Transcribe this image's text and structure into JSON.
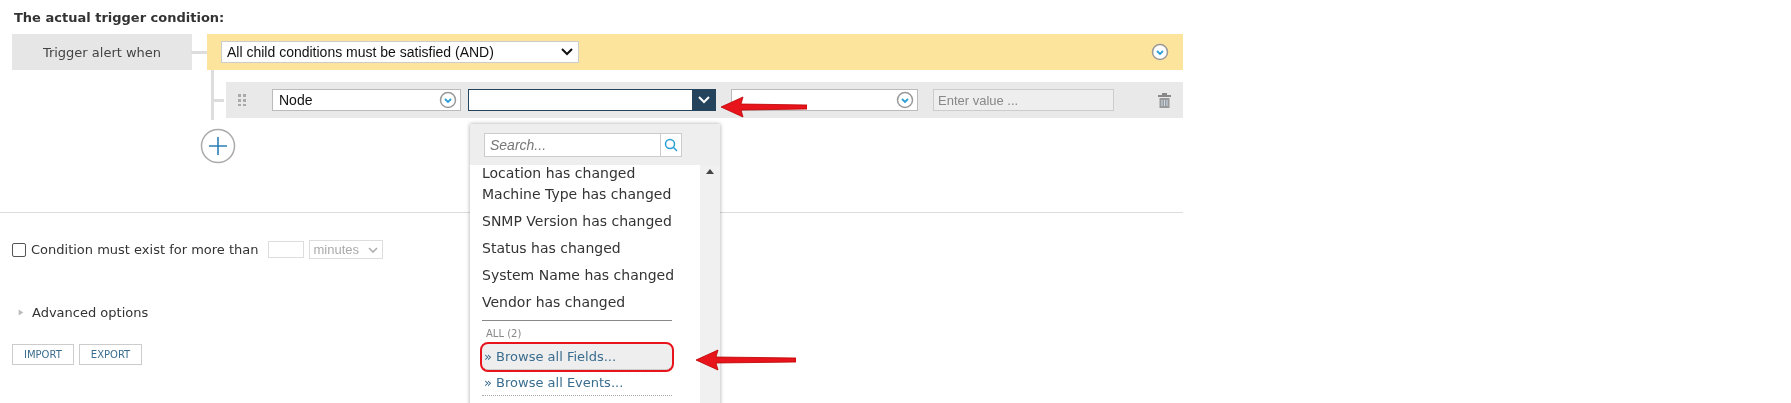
{
  "heading": "The actual trigger condition:",
  "trigger": {
    "label": "Trigger alert when",
    "mode": "All child conditions must be satisfied (AND)"
  },
  "condition": {
    "object": "Node",
    "value_placeholder": "Enter value ..."
  },
  "dropdown": {
    "search_placeholder": "Search...",
    "items": [
      "Location has changed",
      "Machine Type has changed",
      "SNMP Version has changed",
      "Status has changed",
      "System Name has changed",
      "Vendor has changed"
    ],
    "group_label": "ALL (2)",
    "links": [
      {
        "label": "» Browse all Fields...",
        "highlighted": true
      },
      {
        "label": "» Browse all Events...",
        "highlighted": false
      }
    ]
  },
  "duration": {
    "checked": false,
    "label": "Condition must exist for more than",
    "unit": "minutes"
  },
  "advanced": {
    "label": "Advanced options",
    "expanded": false
  },
  "buttons": [
    "IMPORT",
    "EXPORT"
  ]
}
